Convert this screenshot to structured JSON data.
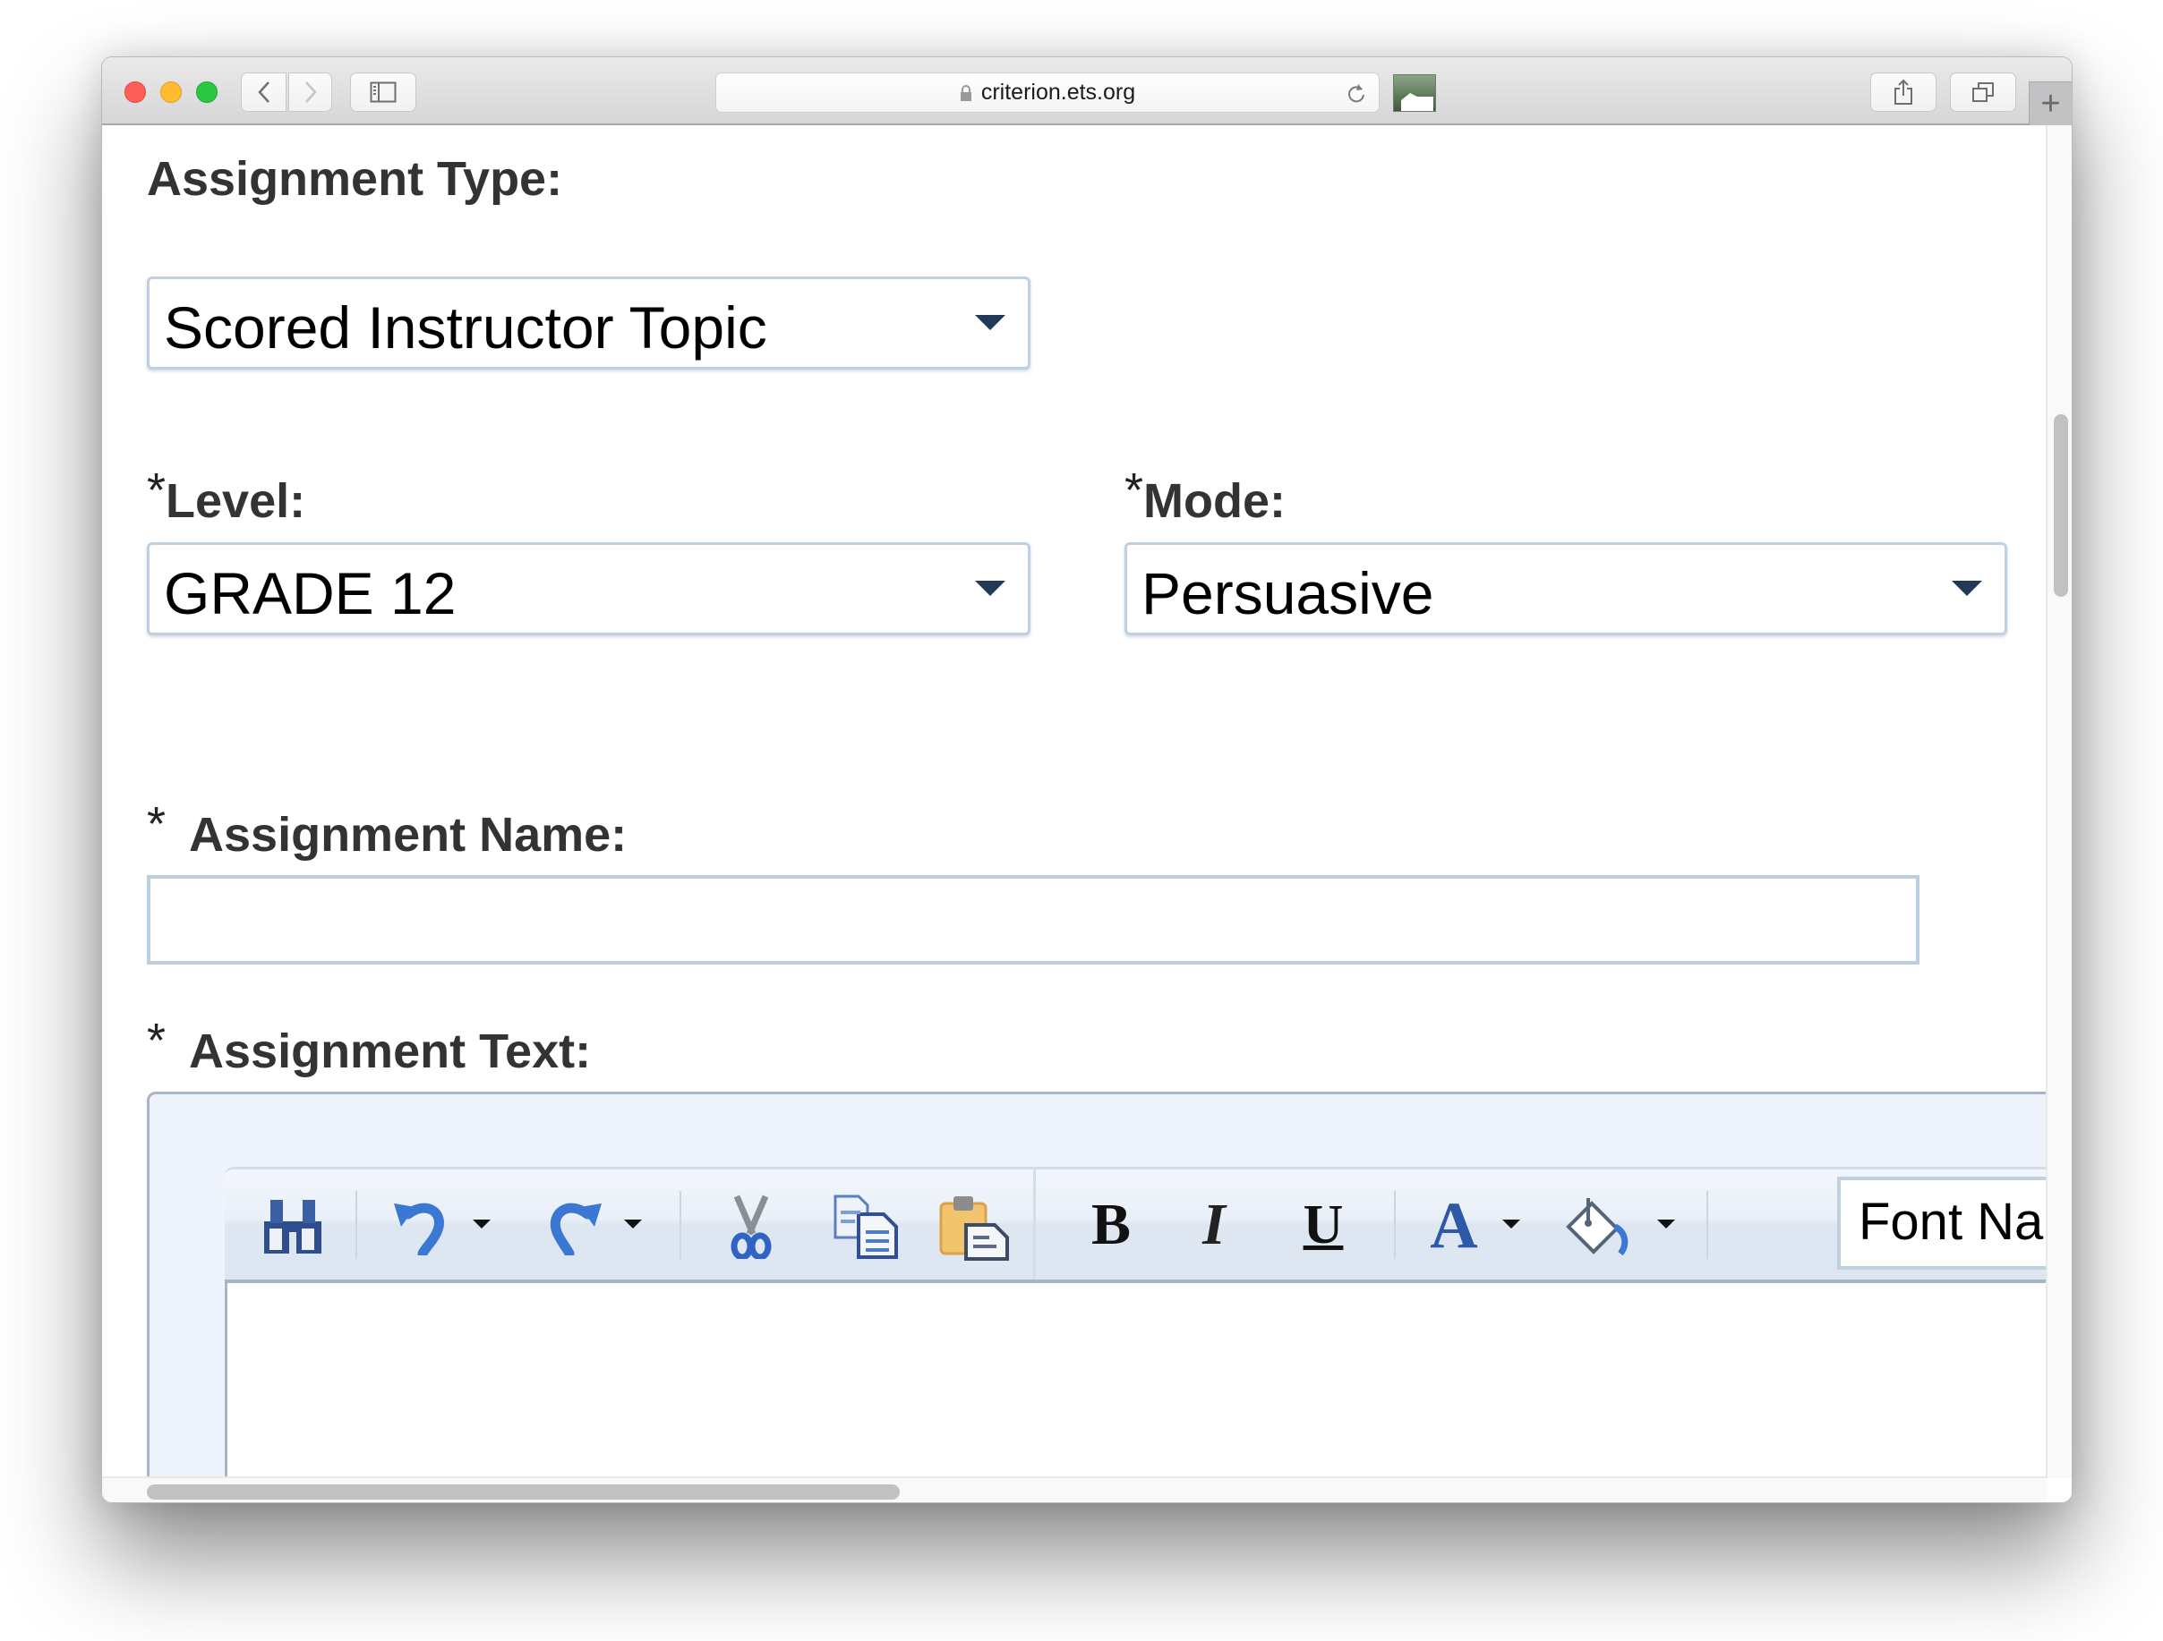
{
  "browser": {
    "url": "criterion.ets.org",
    "icons": {
      "close": "traffic-light-close",
      "minimize": "traffic-light-minimize",
      "zoom": "traffic-light-zoom",
      "back": "chevron-left-icon",
      "forward": "chevron-right-icon",
      "sidebar": "sidebar-icon",
      "lock": "lock-icon",
      "reload": "reload-icon",
      "share": "share-icon",
      "tabs": "tabs-overview-icon",
      "new_tab": "plus-icon"
    },
    "new_tab_label": "+"
  },
  "form": {
    "assignment_type": {
      "label": "Assignment Type:",
      "value": "Scored Instructor Topic"
    },
    "level": {
      "required_mark": "*",
      "label": "Level:",
      "value": "GRADE 12"
    },
    "mode": {
      "required_mark": "*",
      "label": "Mode:",
      "value": "Persuasive"
    },
    "assignment_name": {
      "required_mark": "*",
      "label": "Assignment Name:",
      "value": "",
      "placeholder": ""
    },
    "assignment_text": {
      "required_mark": "*",
      "label": "Assignment Text:",
      "toolbar": {
        "buttons": [
          "find",
          "undo",
          "redo",
          "cut",
          "copy",
          "paste",
          "bold",
          "italic",
          "underline",
          "font-color",
          "highlight-color"
        ],
        "bold_glyph": "B",
        "italic_glyph": "I",
        "underline_glyph": "U",
        "font_color_glyph": "A",
        "font_name_value": "Font Name"
      },
      "value": ""
    }
  },
  "colors": {
    "label": "#333333",
    "select_border": "#bed0e2",
    "caret": "#223a5a",
    "toolbar_icon_blue": "#3b6fc9",
    "paste_orange": "#f3c46e"
  }
}
